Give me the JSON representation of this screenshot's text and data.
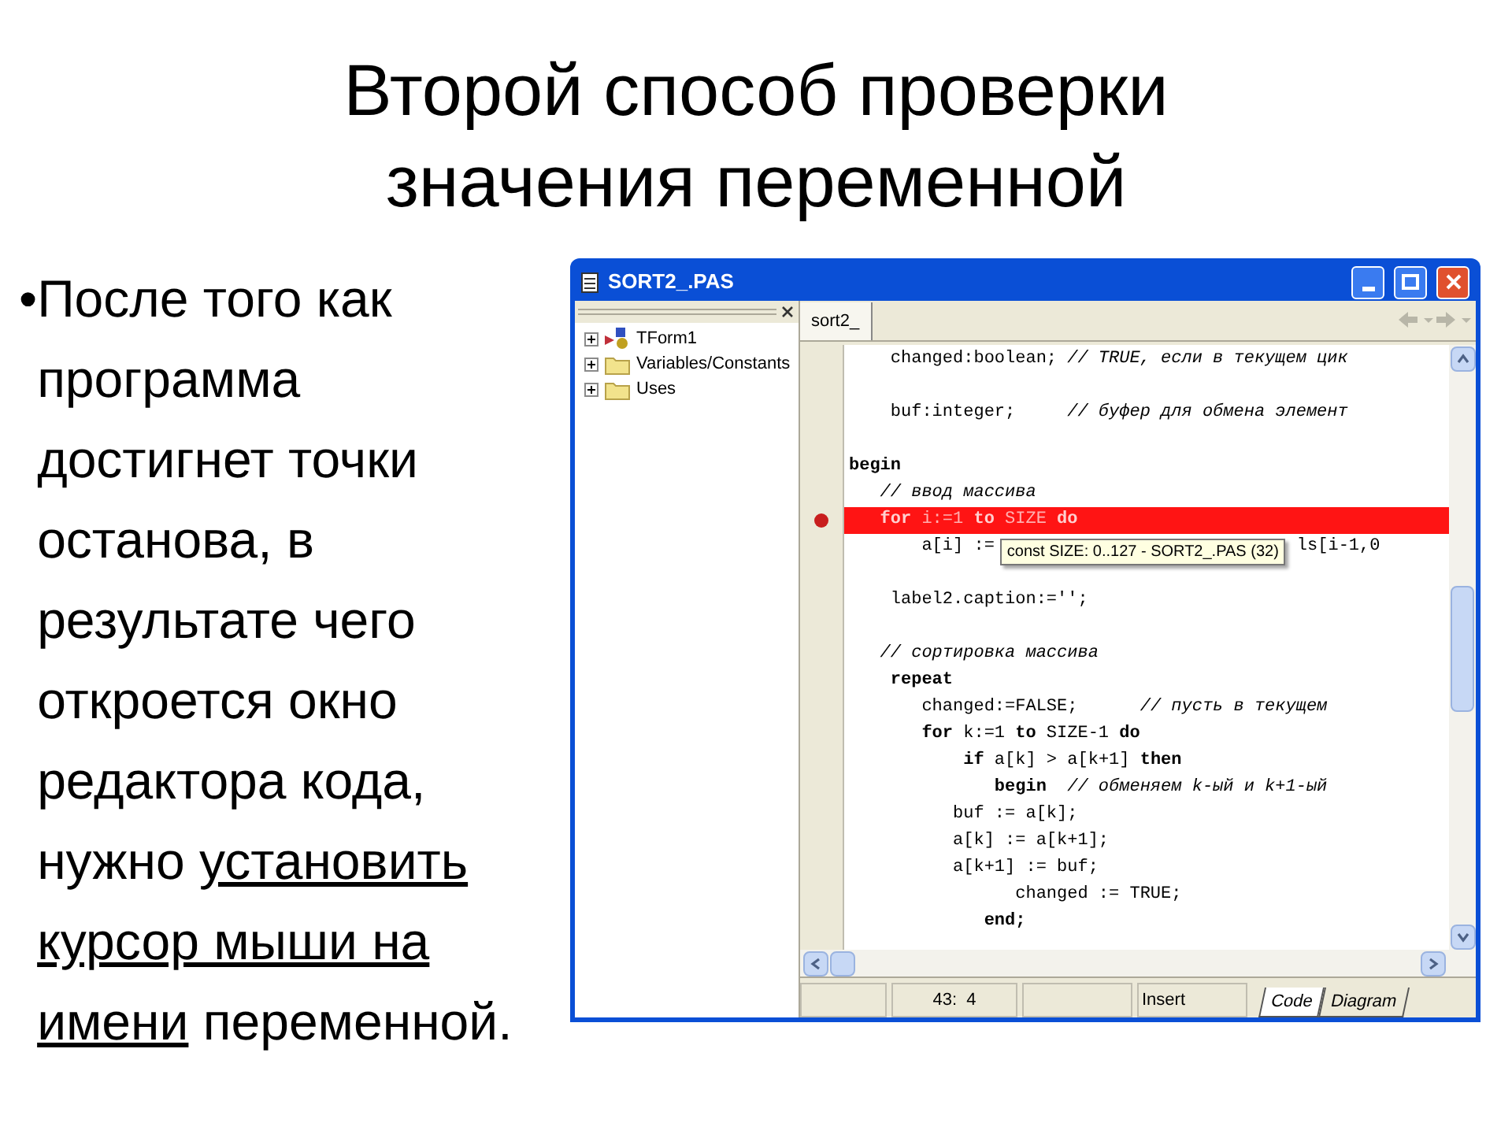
{
  "slide": {
    "bullet_mark": "•",
    "title_lines": [
      "Второй способ проверки",
      "значения переменной"
    ],
    "bullet": {
      "text": "После того как программа достигнет точки останова, в результате чего откроется окно редактора кода, нужно",
      "underlined": "установить курсор мыши на имени",
      "after": "переменной."
    }
  },
  "window": {
    "title": "SORT2_.PAS",
    "tree": [
      {
        "label": "TForm1",
        "kind": "form",
        "expanded": false
      },
      {
        "label": "Variables/Constants",
        "kind": "folder",
        "expanded": false
      },
      {
        "label": "Uses",
        "kind": "folder",
        "expanded": false
      }
    ],
    "tabs": [
      {
        "label": "sort2_",
        "selected": true
      }
    ],
    "code_lines": [
      {
        "breakpoint": false,
        "segments": [
          {
            "kind": "code",
            "text": "    changed:boolean; "
          },
          {
            "kind": "comment",
            "text": "// TRUE, если в текущем цик"
          }
        ]
      },
      {
        "breakpoint": false
      },
      {
        "breakpoint": false,
        "segments": [
          {
            "kind": "code",
            "text": "    buf:integer;     "
          },
          {
            "kind": "comment",
            "text": "// буфер для обмена элемент"
          }
        ]
      },
      {
        "breakpoint": false
      },
      {
        "breakpoint": false,
        "segments": [
          {
            "kind": "keyword",
            "text": "begin"
          }
        ]
      },
      {
        "breakpoint": false,
        "segments": [
          {
            "kind": "comment",
            "text": "   // ввод массива"
          }
        ]
      },
      {
        "breakpoint": true,
        "segments": [
          {
            "kind": "keyword",
            "text": "   for"
          },
          {
            "kind": "code",
            "text": " i:=1 "
          },
          {
            "kind": "keyword",
            "text": "to"
          },
          {
            "kind": "code",
            "text": " SIZE "
          },
          {
            "kind": "keyword",
            "text": "do"
          }
        ]
      },
      {
        "breakpoint": false,
        "segments": [
          {
            "kind": "code",
            "text": "       a[i] :="
          },
          {
            "kind": "code",
            "text": "ls[i-1,0"
          }
        ],
        "tooltip": "const SIZE: 0..127 - SORT2_.PAS (32)"
      },
      {
        "breakpoint": false
      },
      {
        "breakpoint": false,
        "segments": [
          {
            "kind": "code",
            "text": "    label2.caption:='';"
          }
        ]
      },
      {
        "breakpoint": false
      },
      {
        "breakpoint": false,
        "segments": [
          {
            "kind": "comment",
            "text": "   // сортировка массива"
          }
        ]
      },
      {
        "breakpoint": false,
        "segments": [
          {
            "kind": "keyword",
            "text": "    repeat"
          }
        ]
      },
      {
        "breakpoint": false,
        "segments": [
          {
            "kind": "code",
            "text": "       changed:=FALSE;      "
          },
          {
            "kind": "comment",
            "text": "// пусть в текущем"
          }
        ]
      },
      {
        "breakpoint": false,
        "segments": [
          {
            "kind": "keyword",
            "text": "       for"
          },
          {
            "kind": "code",
            "text": " k:=1 "
          },
          {
            "kind": "keyword",
            "text": "to"
          },
          {
            "kind": "code",
            "text": " SIZE-1 "
          },
          {
            "kind": "keyword",
            "text": "do"
          }
        ]
      },
      {
        "breakpoint": false,
        "segments": [
          {
            "kind": "keyword",
            "text": "           if"
          },
          {
            "kind": "code",
            "text": " a[k] > a[k+1] "
          },
          {
            "kind": "keyword",
            "text": "then"
          }
        ]
      },
      {
        "breakpoint": false,
        "segments": [
          {
            "kind": "keyword",
            "text": "              begin"
          },
          {
            "kind": "comment",
            "text": "  // обменяем k-ый и k+1-ый"
          }
        ]
      },
      {
        "breakpoint": false,
        "segments": [
          {
            "kind": "code",
            "text": "          buf := a[k];"
          }
        ]
      },
      {
        "breakpoint": false,
        "segments": [
          {
            "kind": "code",
            "text": "          a[k] := a[k+1];"
          }
        ]
      },
      {
        "breakpoint": false,
        "segments": [
          {
            "kind": "code",
            "text": "          a[k+1] := buf;"
          }
        ]
      },
      {
        "breakpoint": false,
        "segments": [
          {
            "kind": "code",
            "text": "                changed := TRUE;"
          }
        ]
      },
      {
        "breakpoint": false,
        "segments": [
          {
            "kind": "keyword",
            "text": "             end;"
          }
        ]
      }
    ],
    "status_bar": [
      {
        "kind": "empty"
      },
      {
        "kind": "text",
        "text": "43:  4"
      },
      {
        "kind": "empty"
      },
      {
        "kind": "text",
        "text": "Insert"
      }
    ],
    "view_tabs": [
      {
        "label": "Code",
        "selected": true
      },
      {
        "label": "Diagram",
        "selected": false
      }
    ]
  }
}
